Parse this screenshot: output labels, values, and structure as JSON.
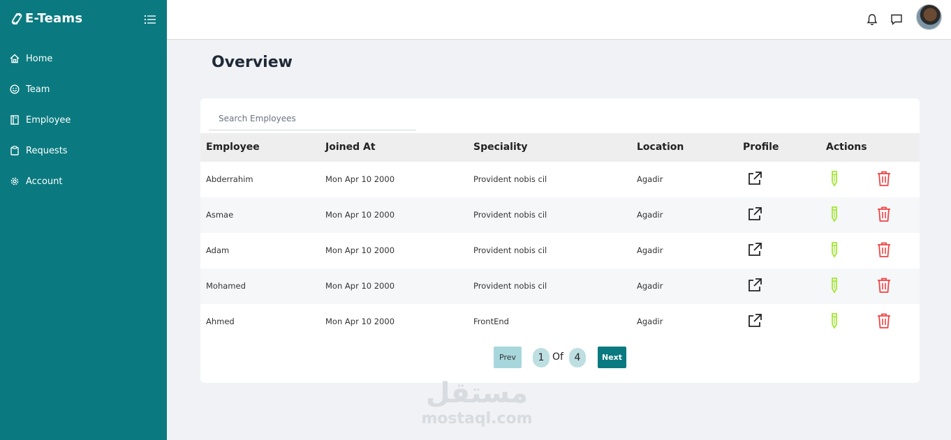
{
  "brand": {
    "name": "E-Teams"
  },
  "sidebar": {
    "items": [
      {
        "label": "Home",
        "icon": "home-icon"
      },
      {
        "label": "Team",
        "icon": "smiley-icon"
      },
      {
        "label": "Employee",
        "icon": "book-icon"
      },
      {
        "label": "Requests",
        "icon": "clipboard-icon"
      },
      {
        "label": "Account",
        "icon": "gear-icon"
      }
    ]
  },
  "topbar": {
    "icons": [
      "bell-icon",
      "chat-icon",
      "avatar"
    ]
  },
  "page": {
    "title": "Overview"
  },
  "search": {
    "placeholder": "Search Employees",
    "value": ""
  },
  "table": {
    "columns": [
      "Employee",
      "Joined At",
      "Speciality",
      "Location",
      "Profile",
      "Actions"
    ],
    "rows": [
      {
        "employee": "Abderrahim",
        "joined": "Mon Apr 10 2000",
        "speciality": "Provident nobis cil",
        "location": "Agadir"
      },
      {
        "employee": "Asmae",
        "joined": "Mon Apr 10 2000",
        "speciality": "Provident nobis cil",
        "location": "Agadir"
      },
      {
        "employee": "Adam",
        "joined": "Mon Apr 10 2000",
        "speciality": "Provident nobis cil",
        "location": "Agadir"
      },
      {
        "employee": "Mohamed",
        "joined": "Mon Apr 10 2000",
        "speciality": "Provident nobis cil",
        "location": "Agadir"
      },
      {
        "employee": "Ahmed",
        "joined": "Mon Apr 10 2000",
        "speciality": "FrontEnd",
        "location": "Agadir"
      }
    ]
  },
  "pagination": {
    "prev_label": "Prev",
    "current": "1",
    "of_label": "Of",
    "total": "4",
    "next_label": "Next"
  },
  "watermark": {
    "arabic": "مستقل",
    "latin": "mostaql.com"
  },
  "colors": {
    "sidebar": "#0a7a80",
    "edit": "#a3e635",
    "delete": "#ef4444",
    "accent": "#0a7a80"
  }
}
